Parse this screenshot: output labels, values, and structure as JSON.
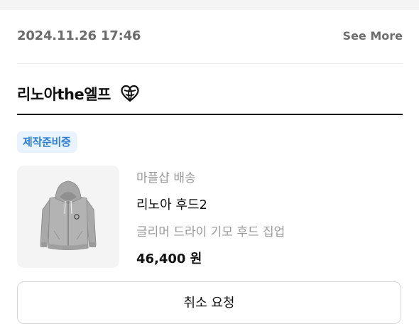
{
  "order": {
    "date": "2024.11.26 17:46",
    "see_more_label": "See More"
  },
  "shop": {
    "name": "리노아the엘프",
    "badge_icon": "globe-heart-icon"
  },
  "status": {
    "label": "제작준비중",
    "color": "#2f7fd7",
    "background": "#e9f3fd"
  },
  "product": {
    "image_icon": "grey-zip-hoodie-image",
    "delivery": "마플샵 배송",
    "name": "리노아 후드2",
    "option": "글리머 드라이 기모 후드 집업",
    "price": "46,400 원"
  },
  "actions": {
    "cancel_label": "취소 요청"
  }
}
